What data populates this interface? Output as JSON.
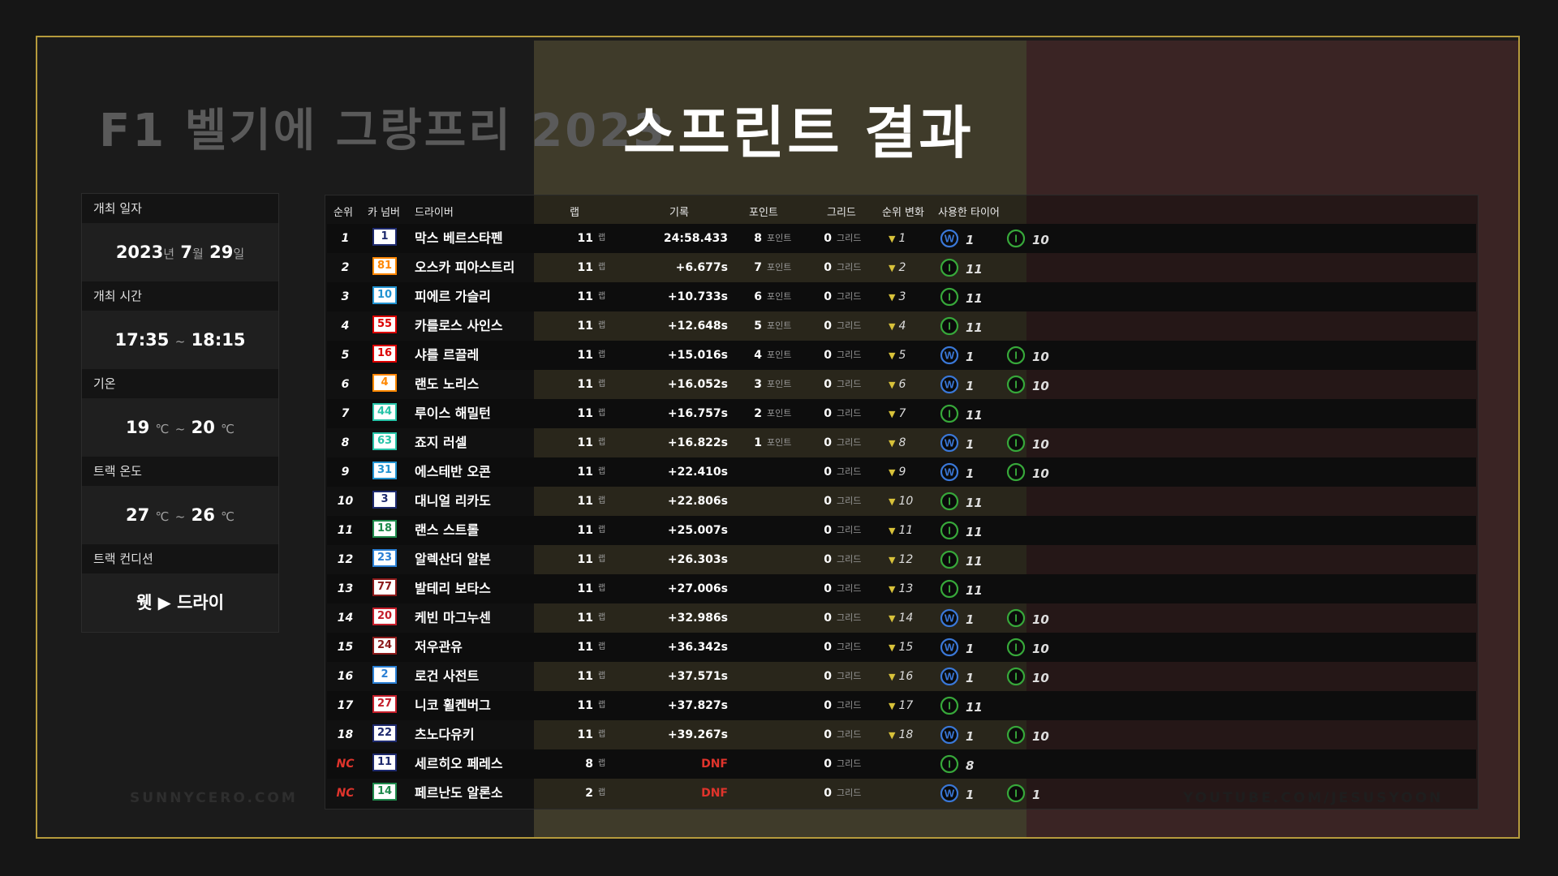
{
  "title": {
    "left": "F1 벨기에 그랑프리 2023",
    "right": "스프린트 결과"
  },
  "watermarks": {
    "left": "SUNNYCERO.COM",
    "right": "YOUTUBE.COM/JESUSYOON"
  },
  "info": {
    "date_label": "개최 일자",
    "date": {
      "y": "2023",
      "yu": "년",
      "m": "7",
      "mu": "월",
      "d": "29",
      "du": "일"
    },
    "time_label": "개최 시간",
    "time": {
      "start": "17:35",
      "sep": "~",
      "end": "18:15"
    },
    "air_label": "기온",
    "air": {
      "lo": "19",
      "hi": "20",
      "unit": "℃",
      "sep": "~"
    },
    "track_label": "트랙 온도",
    "track": {
      "lo": "27",
      "hi": "26",
      "unit": "℃",
      "sep": "~"
    },
    "cond_label": "트랙 컨디션",
    "cond": {
      "from": "웻",
      "arrow": "▶",
      "to": "드라이"
    }
  },
  "headers": {
    "pos": "순위",
    "num": "카 넘버",
    "driver": "드라이버",
    "laps": "랩",
    "time": "기록",
    "points": "포인트",
    "grid": "그리드",
    "change": "순위 변화",
    "tyres": "사용한 타이어"
  },
  "units": {
    "lap": "랩",
    "point": "포인트",
    "grid": "그리드"
  },
  "colors": {
    "wet": "#3a78d8",
    "inter": "#37a83a",
    "accent": "#b59a3c",
    "dnf": "#e0342c",
    "triangle": "#d8c23a"
  },
  "rows": [
    {
      "pos": "1",
      "num": "1",
      "color": "#1e2a6e",
      "driver": "막스 베르스타펜",
      "laps": "11",
      "time": "24:58.433",
      "pts": "8",
      "grid": "0",
      "chg": "1",
      "tyres": [
        {
          "t": "W",
          "n": "1"
        },
        {
          "t": "I",
          "n": "10"
        }
      ]
    },
    {
      "pos": "2",
      "num": "81",
      "color": "#ff8700",
      "driver": "오스카 피아스트리",
      "laps": "11",
      "time": "+6.677s",
      "pts": "7",
      "grid": "0",
      "chg": "2",
      "tyres": [
        {
          "t": "I",
          "n": "11"
        }
      ]
    },
    {
      "pos": "3",
      "num": "10",
      "color": "#2293d1",
      "driver": "피에르 가슬리",
      "laps": "11",
      "time": "+10.733s",
      "pts": "6",
      "grid": "0",
      "chg": "3",
      "tyres": [
        {
          "t": "I",
          "n": "11"
        }
      ]
    },
    {
      "pos": "4",
      "num": "55",
      "color": "#dc0000",
      "driver": "카를로스 사인스",
      "laps": "11",
      "time": "+12.648s",
      "pts": "5",
      "grid": "0",
      "chg": "4",
      "tyres": [
        {
          "t": "I",
          "n": "11"
        }
      ]
    },
    {
      "pos": "5",
      "num": "16",
      "color": "#dc0000",
      "driver": "샤를 르끌레",
      "laps": "11",
      "time": "+15.016s",
      "pts": "4",
      "grid": "0",
      "chg": "5",
      "tyres": [
        {
          "t": "W",
          "n": "1"
        },
        {
          "t": "I",
          "n": "10"
        }
      ]
    },
    {
      "pos": "6",
      "num": "4",
      "color": "#ff8700",
      "driver": "랜도 노리스",
      "laps": "11",
      "time": "+16.052s",
      "pts": "3",
      "grid": "0",
      "chg": "6",
      "tyres": [
        {
          "t": "W",
          "n": "1"
        },
        {
          "t": "I",
          "n": "10"
        }
      ]
    },
    {
      "pos": "7",
      "num": "44",
      "color": "#27c4a8",
      "driver": "루이스 해밀턴",
      "laps": "11",
      "time": "+16.757s",
      "pts": "2",
      "grid": "0",
      "chg": "7",
      "tyres": [
        {
          "t": "I",
          "n": "11"
        }
      ]
    },
    {
      "pos": "8",
      "num": "63",
      "color": "#27c4a8",
      "driver": "죠지 러셀",
      "laps": "11",
      "time": "+16.822s",
      "pts": "1",
      "grid": "0",
      "chg": "8",
      "tyres": [
        {
          "t": "W",
          "n": "1"
        },
        {
          "t": "I",
          "n": "10"
        }
      ]
    },
    {
      "pos": "9",
      "num": "31",
      "color": "#2293d1",
      "driver": "에스테반 오콘",
      "laps": "11",
      "time": "+22.410s",
      "pts": "",
      "grid": "0",
      "chg": "9",
      "tyres": [
        {
          "t": "W",
          "n": "1"
        },
        {
          "t": "I",
          "n": "10"
        }
      ]
    },
    {
      "pos": "10",
      "num": "3",
      "color": "#1e2a6e",
      "driver": "대니얼 리카도",
      "laps": "11",
      "time": "+22.806s",
      "pts": "",
      "grid": "0",
      "chg": "10",
      "tyres": [
        {
          "t": "I",
          "n": "11"
        }
      ]
    },
    {
      "pos": "11",
      "num": "18",
      "color": "#1f8a4c",
      "driver": "랜스 스트롤",
      "laps": "11",
      "time": "+25.007s",
      "pts": "",
      "grid": "0",
      "chg": "11",
      "tyres": [
        {
          "t": "I",
          "n": "11"
        }
      ]
    },
    {
      "pos": "12",
      "num": "23",
      "color": "#2a7fd4",
      "driver": "알렉산더 알본",
      "laps": "11",
      "time": "+26.303s",
      "pts": "",
      "grid": "0",
      "chg": "12",
      "tyres": [
        {
          "t": "I",
          "n": "11"
        }
      ]
    },
    {
      "pos": "13",
      "num": "77",
      "color": "#8b1a1a",
      "driver": "발테리 보타스",
      "laps": "11",
      "time": "+27.006s",
      "pts": "",
      "grid": "0",
      "chg": "13",
      "tyres": [
        {
          "t": "I",
          "n": "11"
        }
      ]
    },
    {
      "pos": "14",
      "num": "20",
      "color": "#c41e2a",
      "driver": "케빈 마그누센",
      "laps": "11",
      "time": "+32.986s",
      "pts": "",
      "grid": "0",
      "chg": "14",
      "tyres": [
        {
          "t": "W",
          "n": "1"
        },
        {
          "t": "I",
          "n": "10"
        }
      ]
    },
    {
      "pos": "15",
      "num": "24",
      "color": "#8b1a1a",
      "driver": "저우관유",
      "laps": "11",
      "time": "+36.342s",
      "pts": "",
      "grid": "0",
      "chg": "15",
      "tyres": [
        {
          "t": "W",
          "n": "1"
        },
        {
          "t": "I",
          "n": "10"
        }
      ]
    },
    {
      "pos": "16",
      "num": "2",
      "color": "#2a7fd4",
      "driver": "로건 사전트",
      "laps": "11",
      "time": "+37.571s",
      "pts": "",
      "grid": "0",
      "chg": "16",
      "tyres": [
        {
          "t": "W",
          "n": "1"
        },
        {
          "t": "I",
          "n": "10"
        }
      ]
    },
    {
      "pos": "17",
      "num": "27",
      "color": "#c41e2a",
      "driver": "니코 휠켄버그",
      "laps": "11",
      "time": "+37.827s",
      "pts": "",
      "grid": "0",
      "chg": "17",
      "tyres": [
        {
          "t": "I",
          "n": "11"
        }
      ]
    },
    {
      "pos": "18",
      "num": "22",
      "color": "#1e2a6e",
      "driver": "츠노다유키",
      "laps": "11",
      "time": "+39.267s",
      "pts": "",
      "grid": "0",
      "chg": "18",
      "tyres": [
        {
          "t": "W",
          "n": "1"
        },
        {
          "t": "I",
          "n": "10"
        }
      ]
    },
    {
      "pos": "NC",
      "num": "11",
      "color": "#1e2a6e",
      "driver": "세르히오 페레스",
      "laps": "8",
      "time": "DNF",
      "pts": "",
      "grid": "0",
      "chg": "",
      "tyres": [
        {
          "t": "I",
          "n": "8"
        }
      ]
    },
    {
      "pos": "NC",
      "num": "14",
      "color": "#1f8a4c",
      "driver": "페르난도 알론소",
      "laps": "2",
      "time": "DNF",
      "pts": "",
      "grid": "0",
      "chg": "",
      "tyres": [
        {
          "t": "W",
          "n": "1"
        },
        {
          "t": "I",
          "n": "1"
        }
      ]
    }
  ]
}
